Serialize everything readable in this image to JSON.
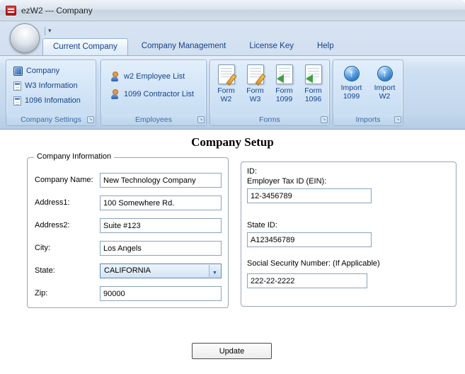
{
  "window": {
    "title": "ezW2 --- Company"
  },
  "ribbon": {
    "tabs": [
      {
        "label": "Current Company"
      },
      {
        "label": "Company Management"
      },
      {
        "label": "License Key"
      },
      {
        "label": "Help"
      }
    ],
    "groups": {
      "company_settings": {
        "caption": "Company Settings",
        "items": [
          {
            "label": "Company",
            "icon": "company-icon"
          },
          {
            "label": "W3 Information",
            "icon": "w3-document-icon"
          },
          {
            "label": "1096 Infomation",
            "icon": "form-1096-document-icon"
          }
        ]
      },
      "employees": {
        "caption": "Employees",
        "items": [
          {
            "label": "w2 Employee List",
            "icon": "employee-person-icon"
          },
          {
            "label": "1099 Contractor List",
            "icon": "contractor-person-icon"
          }
        ]
      },
      "forms": {
        "caption": "Forms",
        "items": [
          {
            "label": "Form W2",
            "icon": "form-edit-icon"
          },
          {
            "label": "Form W3",
            "icon": "form-edit-icon"
          },
          {
            "label": "Form 1099",
            "icon": "form-import-icon"
          },
          {
            "label": "Form 1096",
            "icon": "form-import-icon"
          }
        ]
      },
      "imports": {
        "caption": "Imports",
        "items": [
          {
            "label": "Import 1099",
            "icon": "import-orb-icon"
          },
          {
            "label": "Import W2",
            "icon": "import-orb-icon"
          }
        ]
      }
    }
  },
  "page": {
    "title": "Company Setup",
    "company_info": {
      "legend": "Company Information",
      "company_name": {
        "label": "Company Name:",
        "value": "New Technology Company"
      },
      "address1": {
        "label": "Address1:",
        "value": "100 Somewhere Rd."
      },
      "address2": {
        "label": "Address2:",
        "value": "Suite #123"
      },
      "city": {
        "label": "City:",
        "value": "Los Angels"
      },
      "state": {
        "label": "State:",
        "value": "CALIFORNIA"
      },
      "zip": {
        "label": "Zip:",
        "value": "90000"
      }
    },
    "ids": {
      "heading": "ID:",
      "ein": {
        "label": "Employer Tax ID (EIN):",
        "value": "12-3456789"
      },
      "state_id": {
        "label": "State ID:",
        "value": "A123456789"
      },
      "ssn": {
        "label": "Social Security Number: (If Applicable)",
        "value": "222-22-2222"
      }
    },
    "update_button": "Update"
  }
}
